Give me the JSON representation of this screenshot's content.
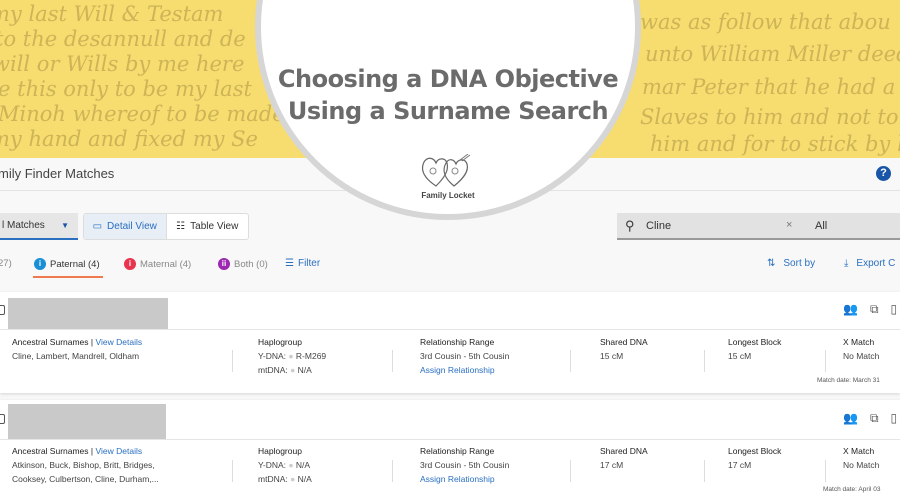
{
  "banner": {
    "handwriting": [
      "my last Will & Testam",
      "to the desannull and de",
      "will or Wills by me here",
      "re this only to be my last",
      "Minoh whereof to be made I",
      "my hand and fixed my Se",
      "was as follow that abou",
      "unto William Miller deed that",
      "mar Peter that he had a li",
      "Slaves to him and not to be",
      "him and for to stick by him"
    ],
    "title_line1": "Choosing a DNA Objective",
    "title_line2": "Using a Surname Search",
    "logo_text": "Family Locket"
  },
  "header": {
    "title": "mily Finder Matches",
    "help_icon": "?"
  },
  "toolbar": {
    "dropdown_value": "l Matches",
    "detail_view": "Detail View",
    "table_view": "Table View",
    "search_value": "Cline",
    "search_clear": "×",
    "search_scope": "All",
    "sort_by": "Sort by",
    "export": "Export C"
  },
  "tabs": {
    "all": "27)",
    "paternal": "Paternal (4)",
    "maternal": "Maternal (4)",
    "both": "Both (0)",
    "filter": "Filter"
  },
  "colors": {
    "paternal": "#1a8fd6",
    "maternal": "#e8344e",
    "both": "#9c27b0",
    "accent": "#2a6fc0",
    "yellow": "#f7dc6f"
  },
  "matches": [
    {
      "surnames_label": "Ancestral Surnames",
      "view_details": "View Details",
      "surnames_line1": "Cline, Lambert, Mandrell, Oldham",
      "surnames_line2": "",
      "haplo_label": "Haplogroup",
      "ydna_label": "Y-DNA:",
      "ydna": "R-M269",
      "mtdna_label": "mtDNA:",
      "mtdna": "N/A",
      "rel_label": "Relationship Range",
      "rel": "3rd Cousin - 5th Cousin",
      "assign": "Assign Relationship",
      "shared_label": "Shared DNA",
      "shared": "15 cM",
      "longest_label": "Longest Block",
      "longest": "15 cM",
      "x_label": "X Match",
      "x": "No Match",
      "date": "Match date: March 31"
    },
    {
      "surnames_label": "Ancestral Surnames",
      "view_details": "View Details",
      "surnames_line1": "Atkinson, Buck, Bishop, Britt, Bridges,",
      "surnames_line2": "Cooksey, Culbertson, Cline, Durham,...",
      "haplo_label": "Haplogroup",
      "ydna_label": "Y-DNA:",
      "ydna": "N/A",
      "mtdna_label": "mtDNA:",
      "mtdna": "N/A",
      "rel_label": "Relationship Range",
      "rel": "3rd Cousin - 5th Cousin",
      "assign": "Assign Relationship",
      "shared_label": "Shared DNA",
      "shared": "17 cM",
      "longest_label": "Longest Block",
      "longest": "17 cM",
      "x_label": "X Match",
      "x": "No Match",
      "date": "Match date: April 03"
    }
  ]
}
